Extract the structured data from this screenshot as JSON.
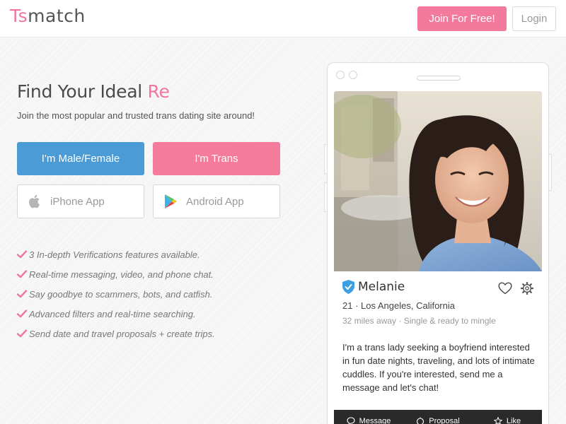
{
  "header": {
    "logo_ts": "Ts",
    "logo_match": "match",
    "join_label": "Join For Free!",
    "login_label": "Login"
  },
  "hero": {
    "title": "Find Your Ideal ",
    "title_accent": "Re",
    "subtitle": "Join the most popular and trusted trans dating site around!",
    "male_female_label": "I'm Male/Female",
    "trans_label": "I'm Trans",
    "iphone_label": "iPhone App",
    "android_label": "Android App"
  },
  "features": [
    "3 In-depth Verifications features available.",
    "Real-time messaging, video, and phone chat.",
    "Say goodbye to scammers, bots, and catfish.",
    "Advanced filters and real-time searching.",
    "Send date and travel proposals + create trips."
  ],
  "profile": {
    "name": "Melanie",
    "location": "21 · Los Angeles, California",
    "meta": "32 miles away · Single & ready to mingle",
    "bio": "I'm a trans lady seeking a boyfriend interested in fun date nights, traveling, and lots of intimate cuddles. If you're interested, send me a message and let's chat!",
    "actions": [
      "Message",
      "Proposal",
      "Like"
    ]
  },
  "colors": {
    "brand_pink": "#f3799d",
    "brand_blue": "#4a9bd6",
    "verified_blue": "#3b9fe0"
  }
}
